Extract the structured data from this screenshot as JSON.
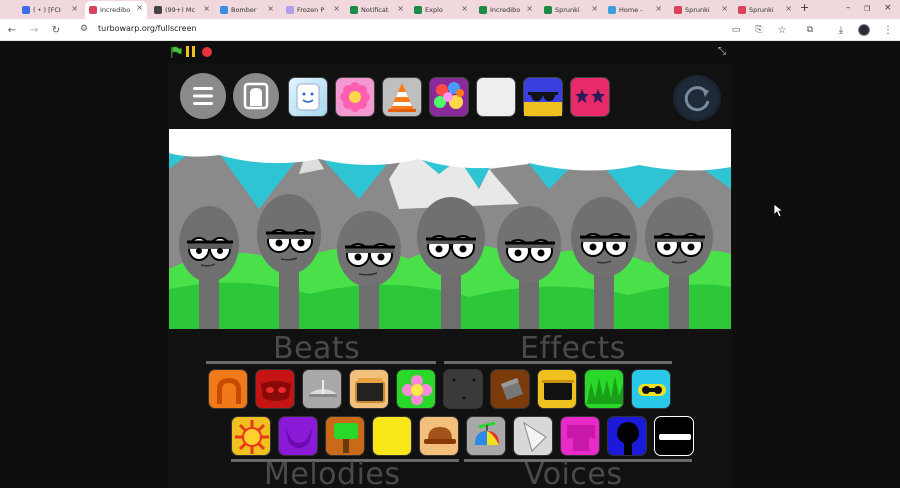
{
  "browser": {
    "tabs": [
      {
        "title": "( • ) [FCI",
        "fav": "#3b6ee8"
      },
      {
        "title": "Incredibo",
        "fav": "#d8425a",
        "active": true
      },
      {
        "title": "(99+) Mc",
        "fav": "#444"
      },
      {
        "title": "Bomber",
        "fav": "#3a8ee0"
      },
      {
        "title": "Frozen P",
        "fav": "#b0a0e8"
      },
      {
        "title": "Notificat",
        "fav": "#1d8a4a"
      },
      {
        "title": "Explo",
        "fav": "#1d8a4a"
      },
      {
        "title": "Incredibo",
        "fav": "#1d8a4a"
      },
      {
        "title": "Sprunki",
        "fav": "#1d8a4a"
      },
      {
        "title": "Home -",
        "fav": "#3aa0e0"
      },
      {
        "title": "Sprunki",
        "fav": "#d8425a"
      },
      {
        "title": "Sprunki",
        "fav": "#d8425a"
      }
    ],
    "new_tab": "+",
    "url": "turbowarp.org/fullscreen"
  },
  "game": {
    "sections": {
      "beats": "Beats",
      "effects": "Effects",
      "melodies": "Melodies",
      "voices": "Voices"
    },
    "top_icons": [
      "menu-icon",
      "robot-head-icon",
      "smile-face-icon",
      "pink-flower-icon",
      "traffic-cone-icon",
      "bubble-cluster-icon",
      "blank-white-icon",
      "sunglasses-icon",
      "star-glasses-icon",
      "reset-icon"
    ],
    "row1": [
      "orange-arch-icon",
      "red-mask-icon",
      "gray-hat-icon",
      "tv-box-icon",
      "green-flower-icon",
      "dark-dots-icon",
      "brown-block-icon",
      "yellow-tv-icon",
      "green-grass-icon",
      "cyan-goggles-icon"
    ],
    "row2": [
      "sun-icon",
      "purple-horns-icon",
      "tree-icon",
      "yellow-square-icon",
      "brown-hat-icon",
      "propeller-cap-icon",
      "white-cone-icon",
      "magenta-shirt-icon",
      "blue-silhouette-icon",
      "black-visor-icon"
    ]
  }
}
